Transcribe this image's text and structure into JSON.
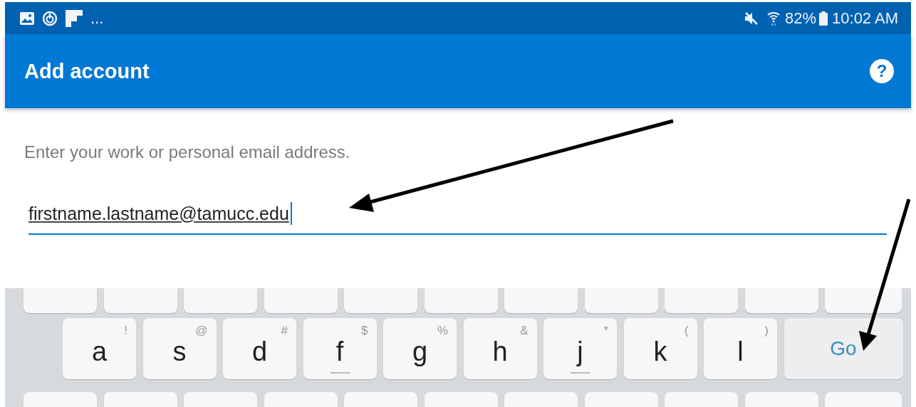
{
  "status_bar": {
    "overflow": "...",
    "battery": "82%",
    "time": "10:02 AM"
  },
  "app_bar": {
    "title": "Add account",
    "help": "?"
  },
  "prompt": "Enter your work or personal email address.",
  "email_field": {
    "value": "firstname.lastname@tamucc.edu",
    "focused": true
  },
  "keyboard": {
    "middle_row": [
      {
        "label": "a",
        "hint": "!",
        "home_mark": false
      },
      {
        "label": "s",
        "hint": "@",
        "home_mark": false
      },
      {
        "label": "d",
        "hint": "#",
        "home_mark": false
      },
      {
        "label": "f",
        "hint": "$",
        "home_mark": true
      },
      {
        "label": "g",
        "hint": "%",
        "home_mark": false
      },
      {
        "label": "h",
        "hint": "&",
        "home_mark": false
      },
      {
        "label": "j",
        "hint": "*",
        "home_mark": true
      },
      {
        "label": "k",
        "hint": "(",
        "home_mark": false
      },
      {
        "label": "l",
        "hint": ")",
        "home_mark": false
      }
    ],
    "action_key": "Go"
  }
}
